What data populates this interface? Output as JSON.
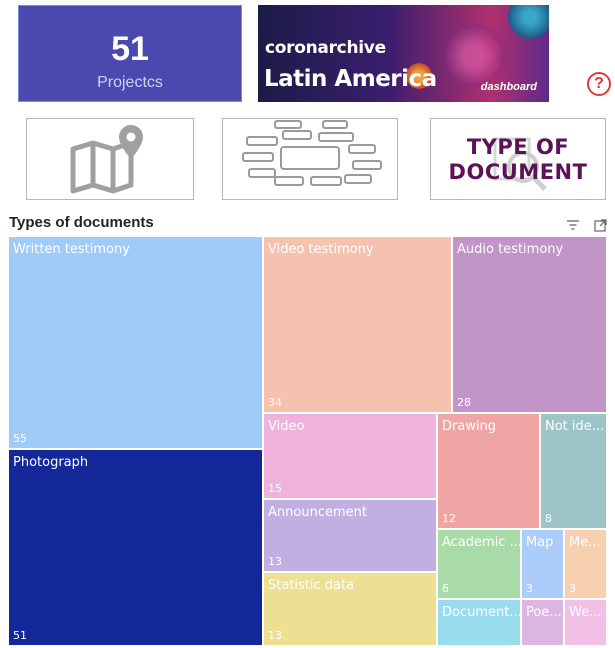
{
  "kpi": {
    "value": "51",
    "label": "Projectcs"
  },
  "banner": {
    "subtitle": "coronarchive",
    "title": "Latin America",
    "tag": "dashboard"
  },
  "help_glyph": "?",
  "nav": {
    "map_icon": "map-pin-icon",
    "network_icon": "network-graph-icon",
    "type_line1": "TYPE OF",
    "type_line2": "DOCUMENT"
  },
  "visual": {
    "title": "Types of documents",
    "filter_icon": "filter-icon",
    "focus_icon": "focus-mode-icon"
  },
  "chart_data": {
    "type": "treemap",
    "title": "Types of documents",
    "items": [
      {
        "name": "Written testimony",
        "value": 55,
        "color": "#9fcbfb"
      },
      {
        "name": "Photograph",
        "value": 51,
        "color": "#14289a"
      },
      {
        "name": "Video testimony",
        "value": 34,
        "color": "#f4c2ae"
      },
      {
        "name": "Audio testimony",
        "value": 28,
        "color": "#c295c8"
      },
      {
        "name": "Video",
        "value": 15,
        "color": "#eeb2dd"
      },
      {
        "name": "Announcement",
        "value": 13,
        "color": "#c0b0e2"
      },
      {
        "name": "Statistic data",
        "value": 13,
        "color": "#eee093"
      },
      {
        "name": "Drawing",
        "value": 12,
        "color": "#eea5a4"
      },
      {
        "name": "Not ide...",
        "value": 8,
        "color": "#9dc4c6"
      },
      {
        "name": "Academic ...",
        "value": 6,
        "color": "#a9dba8"
      },
      {
        "name": "Map",
        "value": 3,
        "color": "#acccfa"
      },
      {
        "name": "Me...",
        "value": 3,
        "color": "#f7d1af"
      },
      {
        "name": "Document...",
        "value": null,
        "color": "#99dcf0"
      },
      {
        "name": "Poe...",
        "value": null,
        "color": "#ddb6e3"
      },
      {
        "name": "We...",
        "value": null,
        "color": "#f2bfe6"
      }
    ]
  }
}
